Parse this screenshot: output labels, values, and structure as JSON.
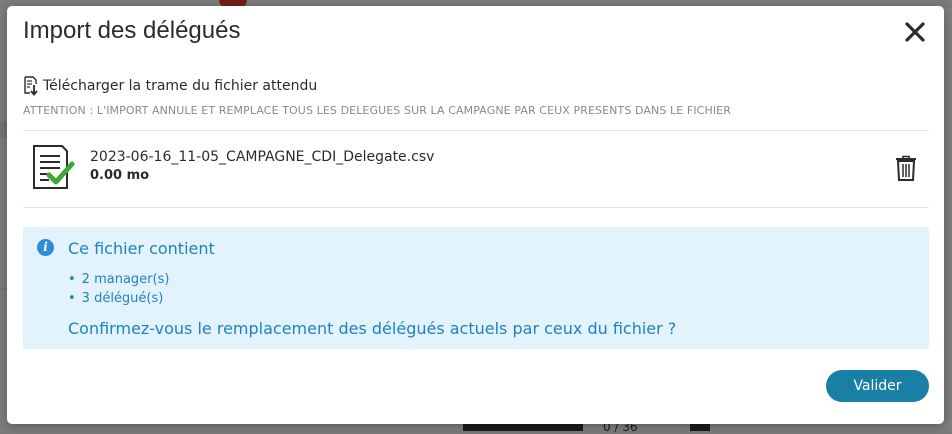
{
  "background": {
    "counter_text": "0 / 36"
  },
  "modal": {
    "title": "Import des délégués",
    "close_icon": "close-icon",
    "download_icon": "download-template-icon",
    "download_label": "Télécharger la trame du fichier attendu",
    "warning": "ATTENTION : L'IMPORT ANNULE ET REMPLACE TOUS LES DELEGUES SUR LA CAMPAGNE PAR CEUX PRESENTS DANS LE FICHIER"
  },
  "file": {
    "icon": "file-check-icon",
    "name": "2023-06-16_11-05_CAMPAGNE_CDI_Delegate.csv",
    "size": "0.00 mo",
    "delete_icon": "trash-icon"
  },
  "info": {
    "icon": "info-icon",
    "title": "Ce fichier contient",
    "items": [
      "2 manager(s)",
      "3 délégué(s)"
    ],
    "question": "Confirmez-vous le remplacement des délégués actuels par ceux du fichier ?"
  },
  "actions": {
    "validate_label": "Valider"
  },
  "colors": {
    "accent": "#1a7fa4",
    "info_text": "#1f82c0",
    "info_bg": "#e2f3fd",
    "check_green": "#3da935"
  }
}
